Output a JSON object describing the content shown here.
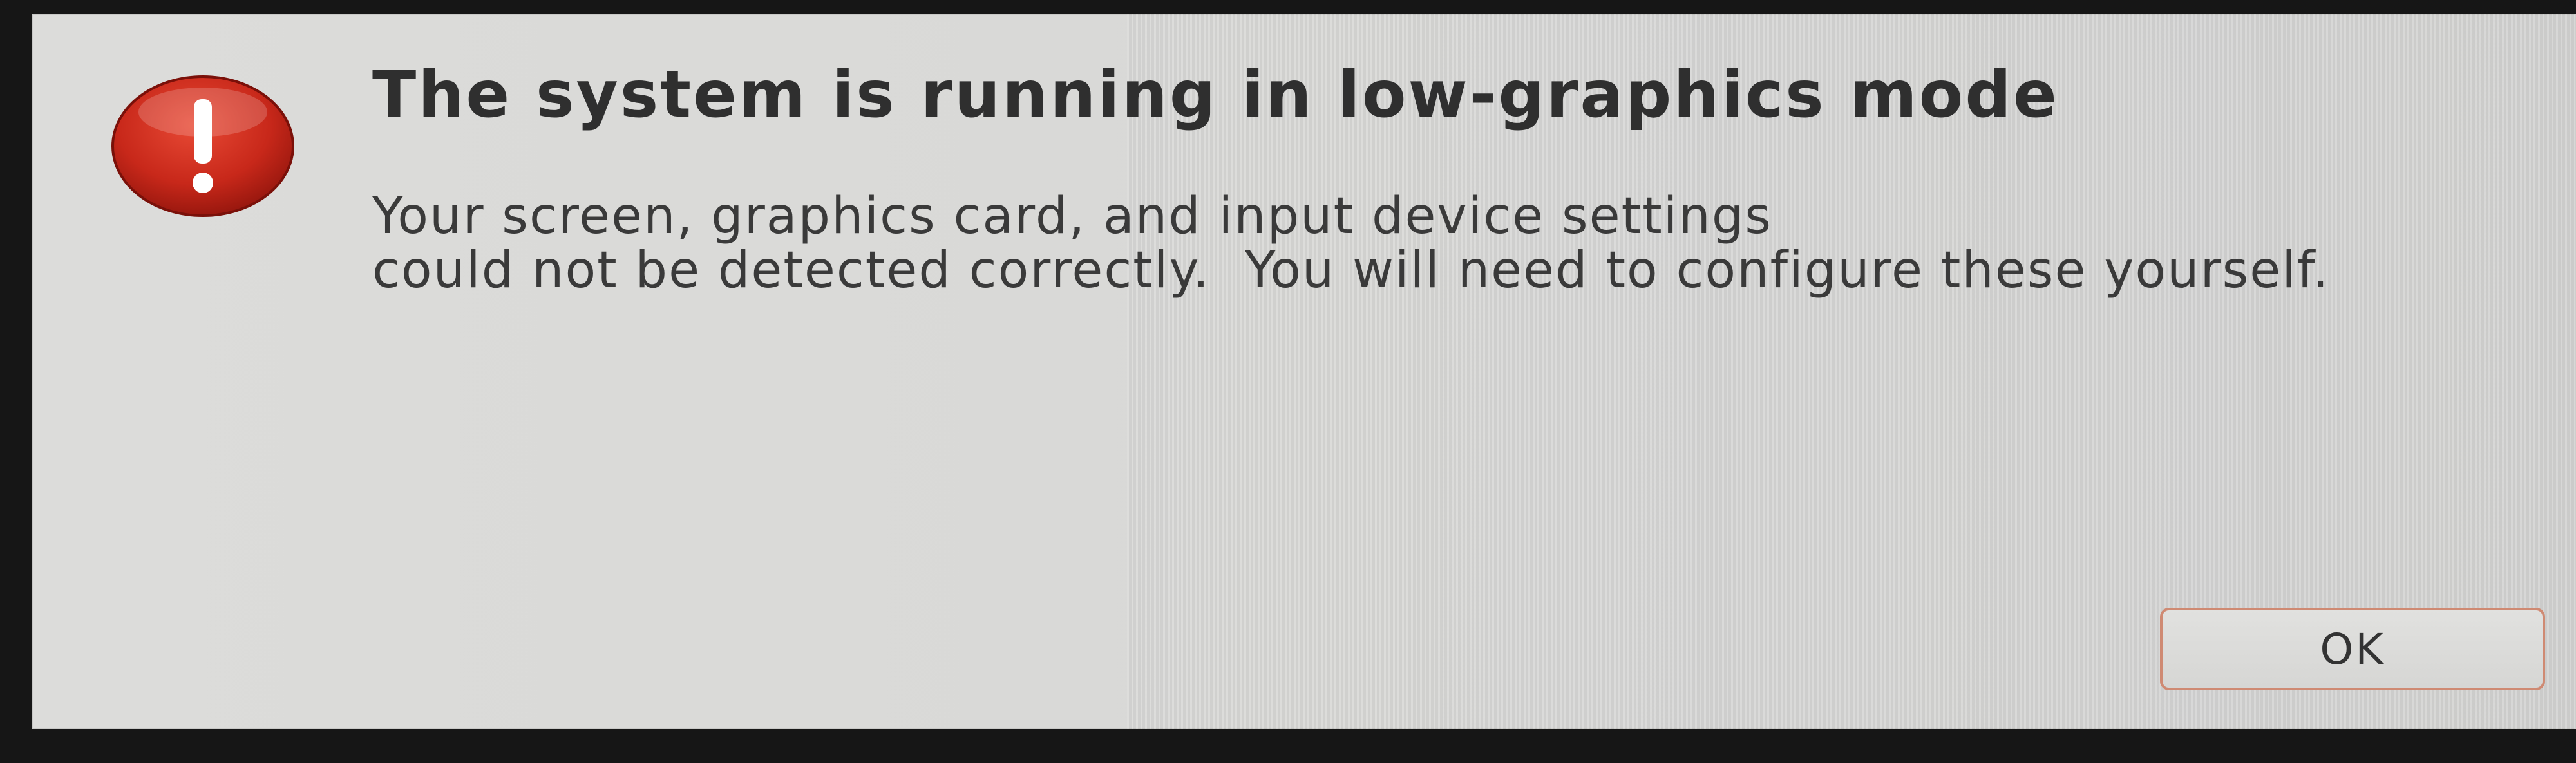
{
  "dialog": {
    "icon": "error-exclamation-icon",
    "title": "The system is running in low-graphics mode",
    "message_lines": [
      "Your screen, graphics card, and input device settings",
      "could not be detected correctly.  You will need to configure these yourself."
    ],
    "ok_label": "OK"
  },
  "colors": {
    "dialog_background": "#dcdcda",
    "icon_red": "#c8281a",
    "button_border": "#cf8a73",
    "text": "#2f2f2f"
  }
}
